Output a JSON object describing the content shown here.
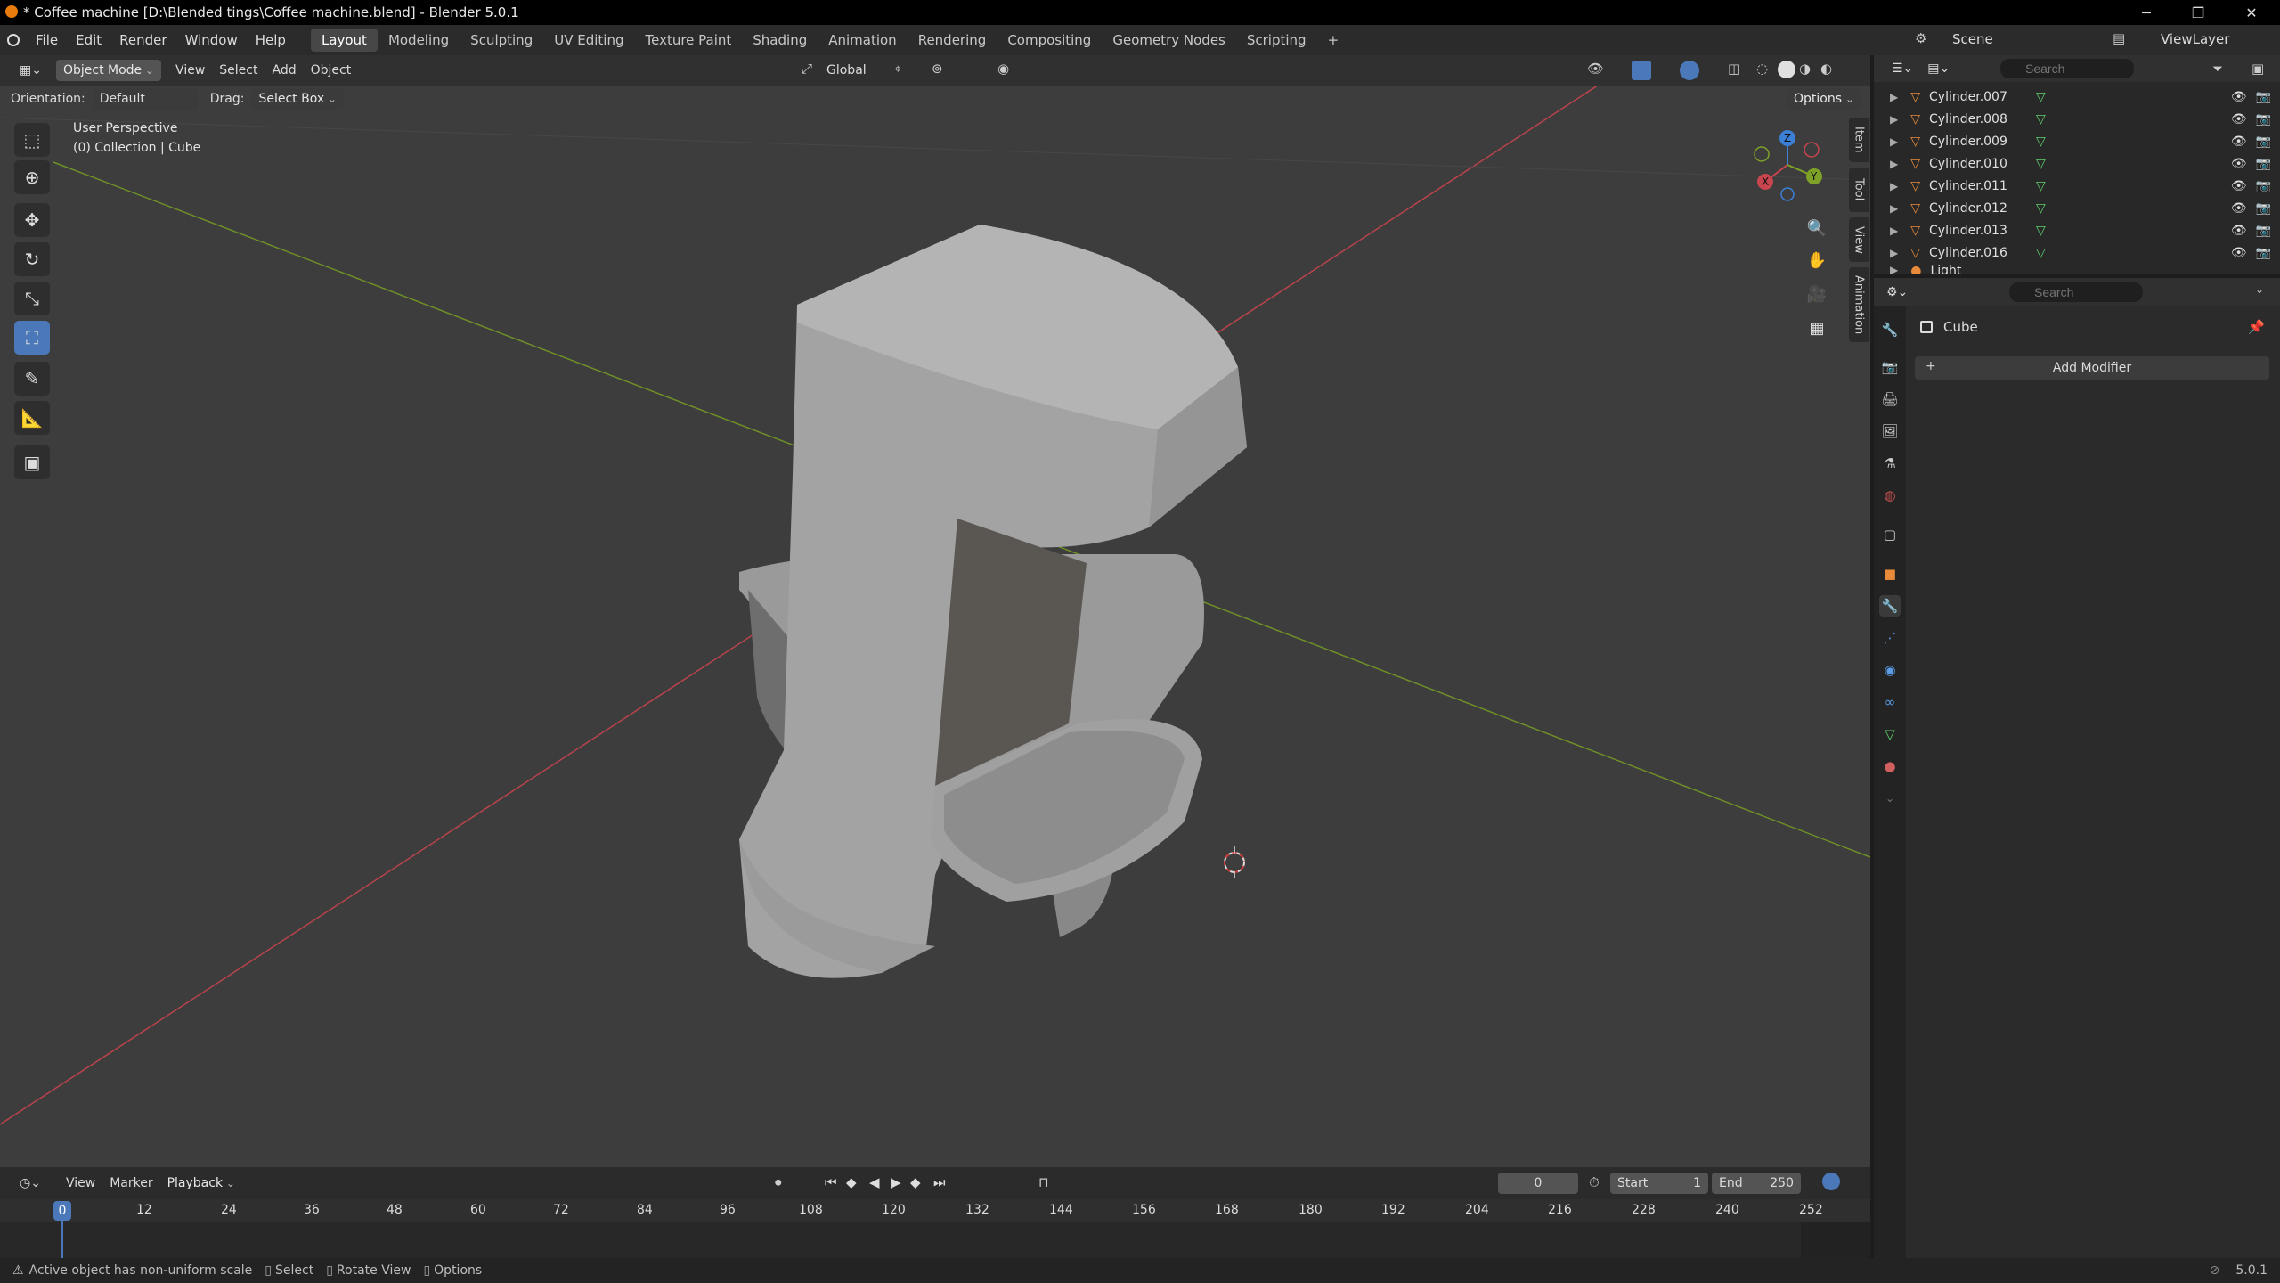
{
  "titlebar": {
    "title": "* Coffee machine [D:\\Blended tings\\Coffee machine.blend] - Blender 5.0.1",
    "minimize": "─",
    "restore": "❐",
    "close": "✕"
  },
  "menus": [
    "File",
    "Edit",
    "Render",
    "Window",
    "Help"
  ],
  "workspaces": [
    "Layout",
    "Modeling",
    "Sculpting",
    "UV Editing",
    "Texture Paint",
    "Shading",
    "Animation",
    "Rendering",
    "Compositing",
    "Geometry Nodes",
    "Scripting"
  ],
  "workspace_add": "+",
  "scene": {
    "label": "Scene",
    "viewlayer": "ViewLayer"
  },
  "viewport": {
    "mode": "Object Mode",
    "menus": [
      "View",
      "Select",
      "Add",
      "Object"
    ],
    "transform_orientation": "Global",
    "orientation_label": "Orientation:",
    "orientation_value": "Default",
    "drag_label": "Drag:",
    "drag_value": "Select Box",
    "options": "Options",
    "perspective": "User Perspective",
    "collection": "(0) Collection | Cube",
    "side_tabs": [
      "Item",
      "Tool",
      "View",
      "Animation"
    ],
    "gizmo": {
      "x": "X",
      "y": "Y",
      "z": "Z"
    }
  },
  "outliner": {
    "search_placeholder": "Search",
    "items": [
      "Cylinder.007",
      "Cylinder.008",
      "Cylinder.009",
      "Cylinder.010",
      "Cylinder.011",
      "Cylinder.012",
      "Cylinder.013",
      "Cylinder.016",
      "Light"
    ]
  },
  "properties": {
    "search_placeholder": "Search",
    "object_name": "Cube",
    "add_modifier": "Add Modifier"
  },
  "timeline": {
    "menus": [
      "View",
      "Marker",
      "Playback"
    ],
    "current_frame": "0",
    "start_label": "Start",
    "start": "1",
    "end_label": "End",
    "end": "250",
    "ticks": [
      "0",
      "12",
      "24",
      "36",
      "48",
      "60",
      "72",
      "84",
      "96",
      "108",
      "120",
      "132",
      "144",
      "156",
      "168",
      "180",
      "192",
      "204",
      "216",
      "228",
      "240",
      "252"
    ]
  },
  "status": {
    "message": "Active object has non-uniform scale",
    "select": "Select",
    "rotate": "Rotate View",
    "options": "Options",
    "version": "5.0.1"
  },
  "colors": {
    "accent": "#4a78b9",
    "x_axis": "#c8454f",
    "y_axis": "#7ea127",
    "z_axis": "#3b7fd6",
    "mesh_icon": "#e88a3a",
    "data_icon": "#5fd16d"
  }
}
